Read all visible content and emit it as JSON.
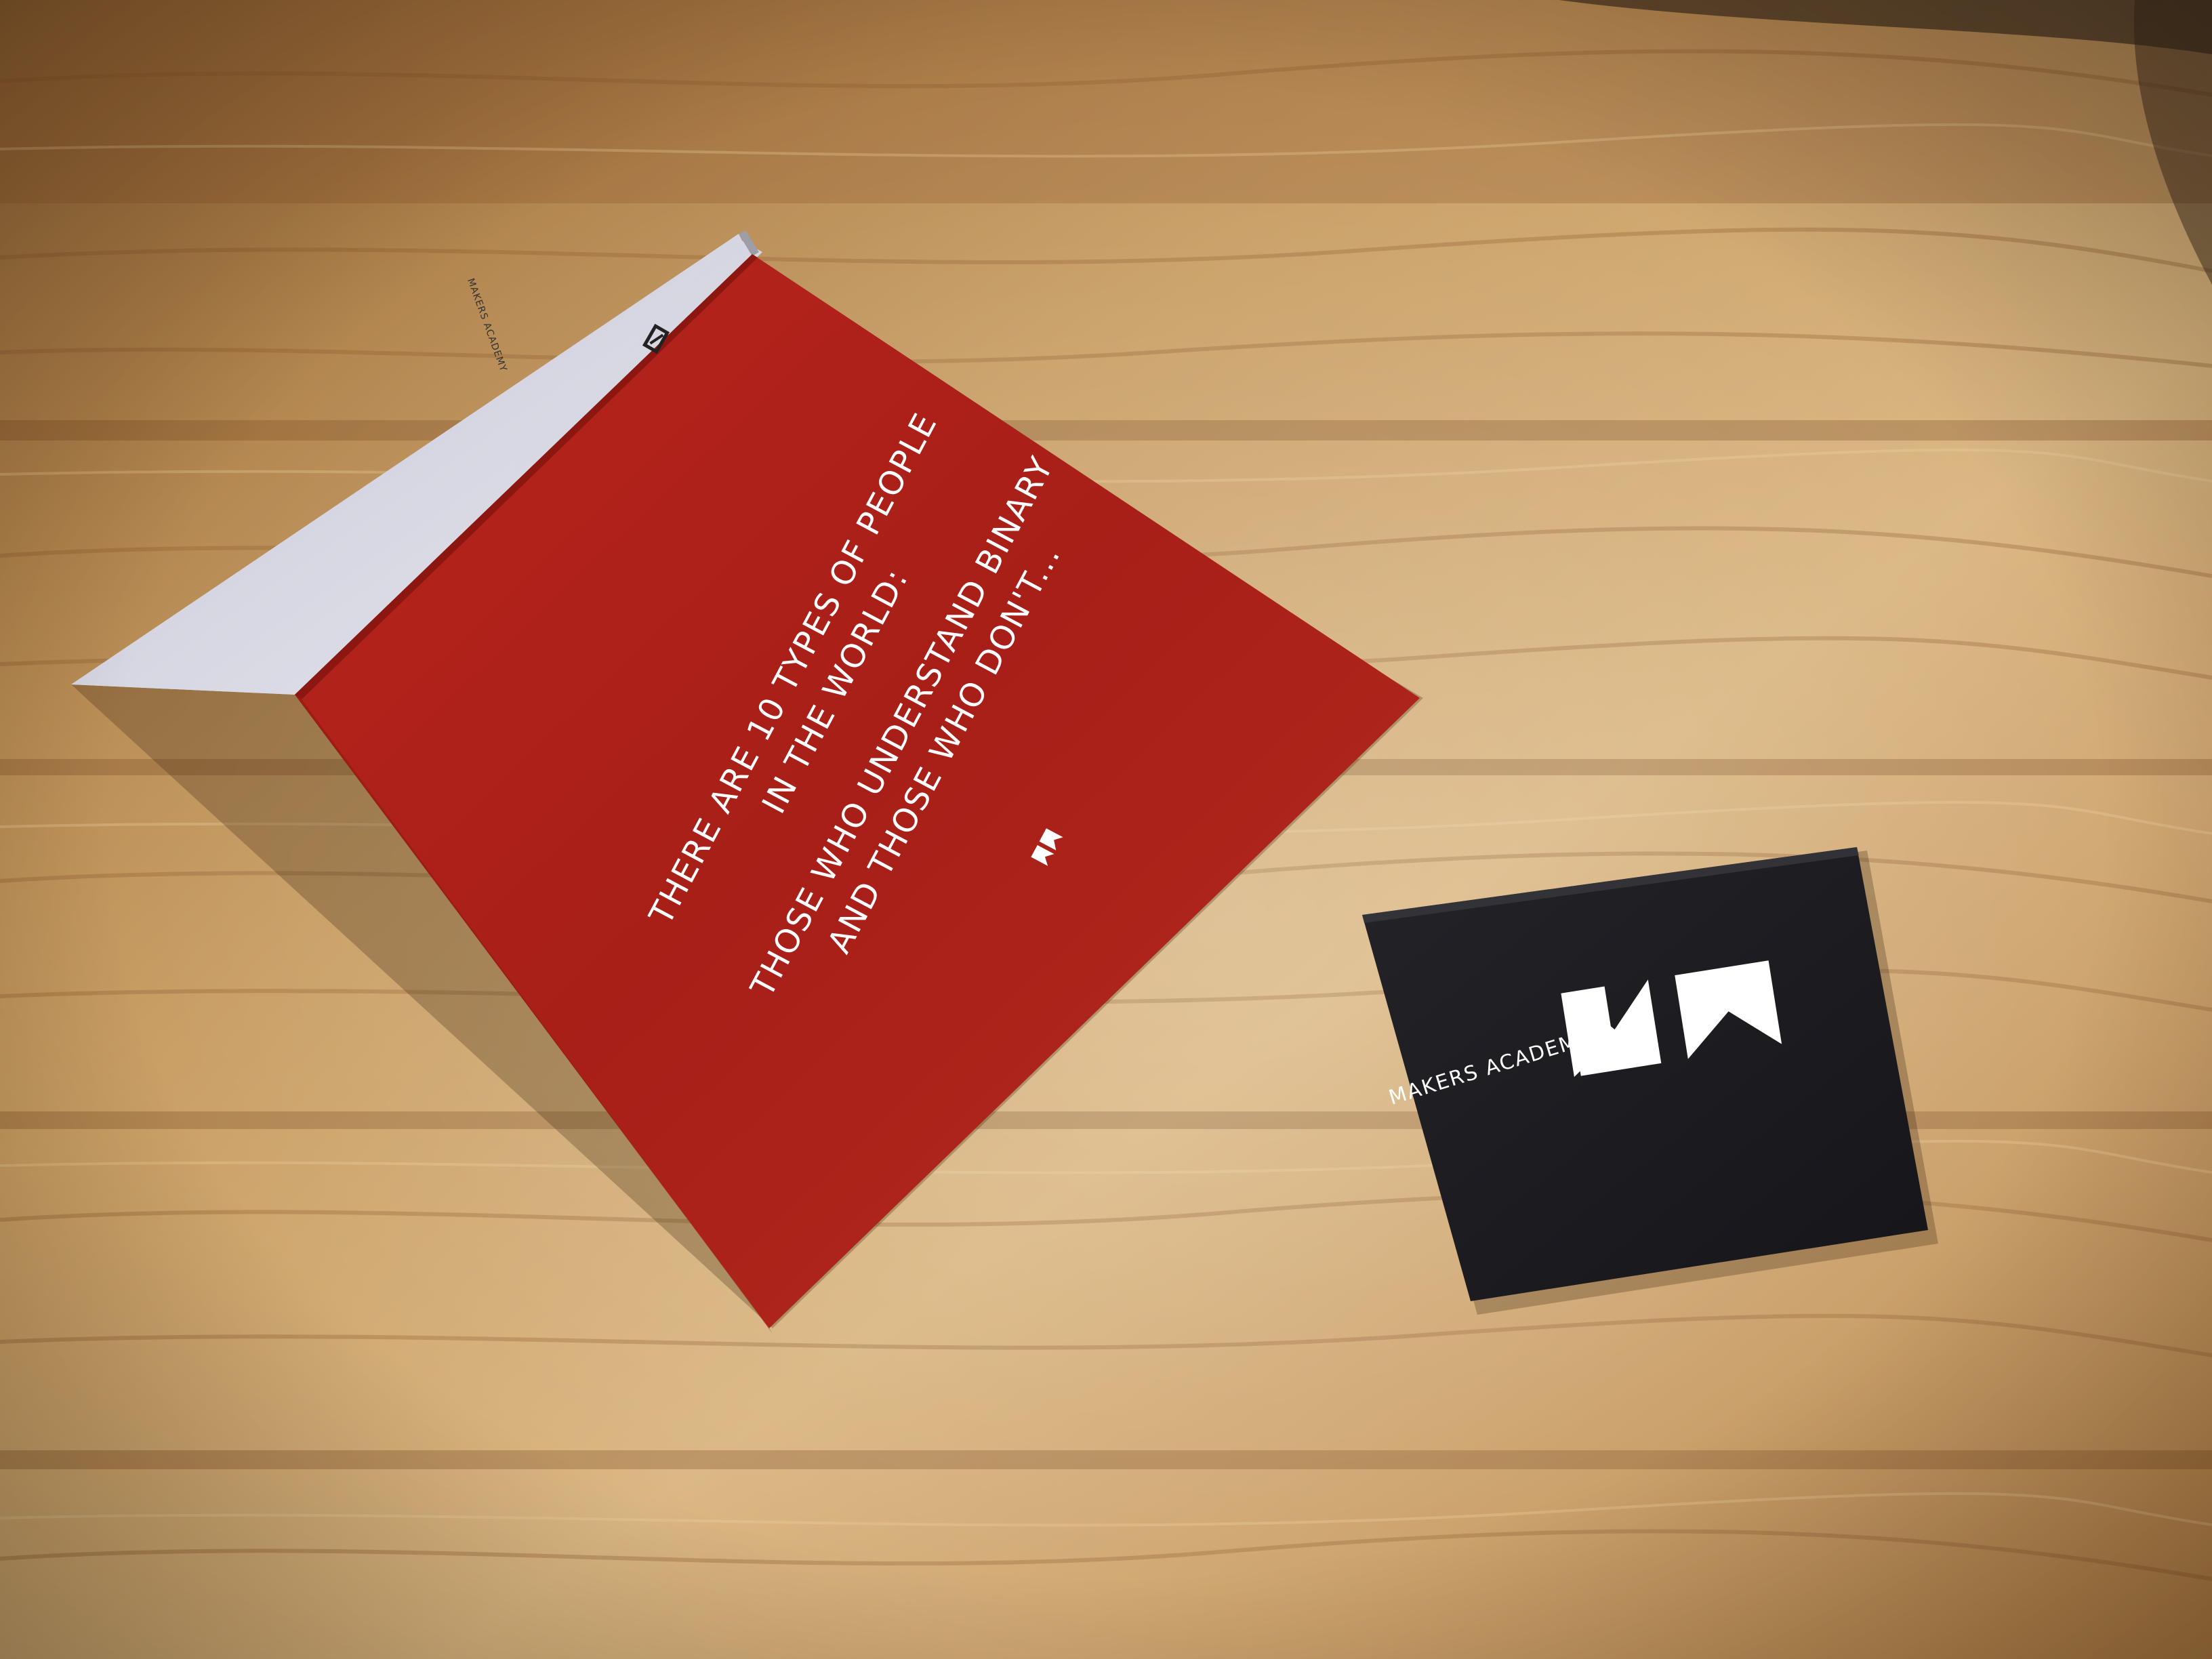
{
  "greeting_card": {
    "line1": "THERE ARE 10 TYPES OF PEOPLE",
    "line2": "IN THE WORLD:",
    "line3": "THOSE WHO UNDERSTAND BINARY",
    "line4": "AND THOSE WHO DON'T...",
    "spine_label": "MAKERS ACADEMY",
    "color": "#b0201a"
  },
  "business_card": {
    "brand_name": "MAKERS ACADEMY",
    "color": "#1d1d22"
  },
  "logo": {
    "icon": "makers-academy-logo-icon"
  }
}
